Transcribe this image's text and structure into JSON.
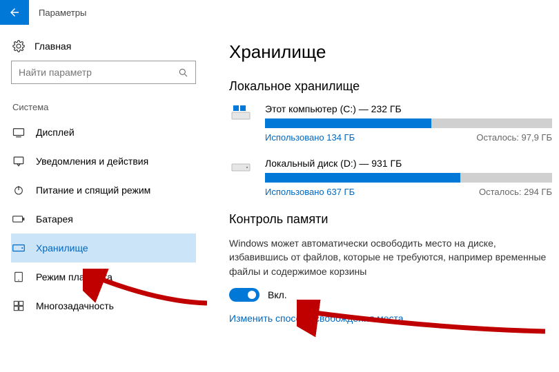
{
  "header": {
    "title": "Параметры"
  },
  "sidebar": {
    "home": "Главная",
    "search_placeholder": "Найти параметр",
    "section": "Система",
    "items": [
      {
        "label": "Дисплей"
      },
      {
        "label": "Уведомления и действия"
      },
      {
        "label": "Питание и спящий режим"
      },
      {
        "label": "Батарея"
      },
      {
        "label": "Хранилище"
      },
      {
        "label": "Режим планшета"
      },
      {
        "label": "Многозадачность"
      }
    ]
  },
  "main": {
    "title": "Хранилище",
    "local_title": "Локальное хранилище",
    "drives": [
      {
        "title": "Этот компьютер (C:) — 232 ГБ",
        "used": "Использовано 134 ГБ",
        "free": "Осталось: 97,9 ГБ",
        "fill_pct": 58
      },
      {
        "title": "Локальный диск (D:) — 931 ГБ",
        "used": "Использовано 637 ГБ",
        "free": "Осталось: 294 ГБ",
        "fill_pct": 68
      }
    ],
    "storage_sense": {
      "title": "Контроль памяти",
      "desc": "Windows может автоматически освободить место на диске, избавившись от файлов, которые не требуются, например временные файлы и содержимое корзины",
      "toggle_label": "Вкл.",
      "link": "Изменить способ освобождения места"
    }
  }
}
